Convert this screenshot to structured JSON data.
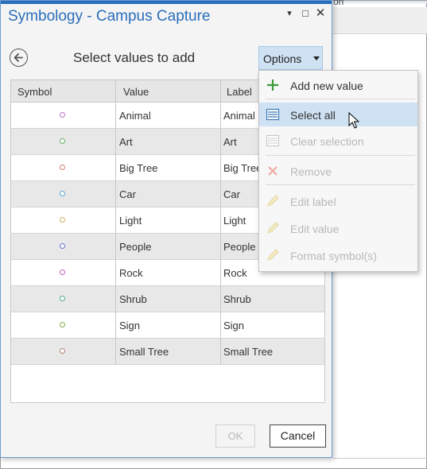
{
  "background_app": {
    "top_fragment": "on"
  },
  "dialog": {
    "title": "Symbology - Campus Capture",
    "window_controls": {
      "pin": "▾",
      "maximize": "□",
      "close": "✕"
    },
    "header_label": "Select values to add",
    "options_button": "Options",
    "table": {
      "columns": [
        "Symbol",
        "Value",
        "Label"
      ],
      "rows": [
        {
          "value": "Animal",
          "label": "Animal",
          "color": "#c070d0"
        },
        {
          "value": "Art",
          "label": "Art",
          "color": "#60b060"
        },
        {
          "value": "Big Tree",
          "label": "Big Tree",
          "color": "#d08070"
        },
        {
          "value": "Car",
          "label": "Car",
          "color": "#60a8d0"
        },
        {
          "value": "Light",
          "label": "Light",
          "color": "#d0b060"
        },
        {
          "value": "People",
          "label": "People",
          "color": "#6070d0"
        },
        {
          "value": "Rock",
          "label": "Rock",
          "color": "#c060c0"
        },
        {
          "value": "Shrub",
          "label": "Shrub",
          "color": "#50a890"
        },
        {
          "value": "Sign",
          "label": "Sign",
          "color": "#80b050"
        },
        {
          "value": "Small Tree",
          "label": "Small Tree",
          "color": "#b08070"
        }
      ]
    },
    "ok_button": "OK",
    "cancel_button": "Cancel"
  },
  "options_menu": {
    "items": [
      {
        "label": "Add new value",
        "icon": "plus-icon",
        "enabled": true
      },
      {
        "label": "Select all",
        "icon": "select-all-icon",
        "enabled": true,
        "hovered": true
      },
      {
        "label": "Clear selection",
        "icon": "clear-selection-icon",
        "enabled": false
      },
      {
        "label": "Remove",
        "icon": "remove-icon",
        "enabled": false
      },
      {
        "label": "Edit label",
        "icon": "pencil-icon",
        "enabled": false
      },
      {
        "label": "Edit value",
        "icon": "pencil-icon",
        "enabled": false
      },
      {
        "label": "Format symbol(s)",
        "icon": "pencil-icon",
        "enabled": false
      }
    ]
  },
  "colors": {
    "accent": "#2a6ebb",
    "options_bg": "#cfe2f3",
    "add_icon": "#3a9a3a",
    "remove_icon_disabled": "#f0a8a0",
    "pencil_disabled": "#e8dca0"
  }
}
